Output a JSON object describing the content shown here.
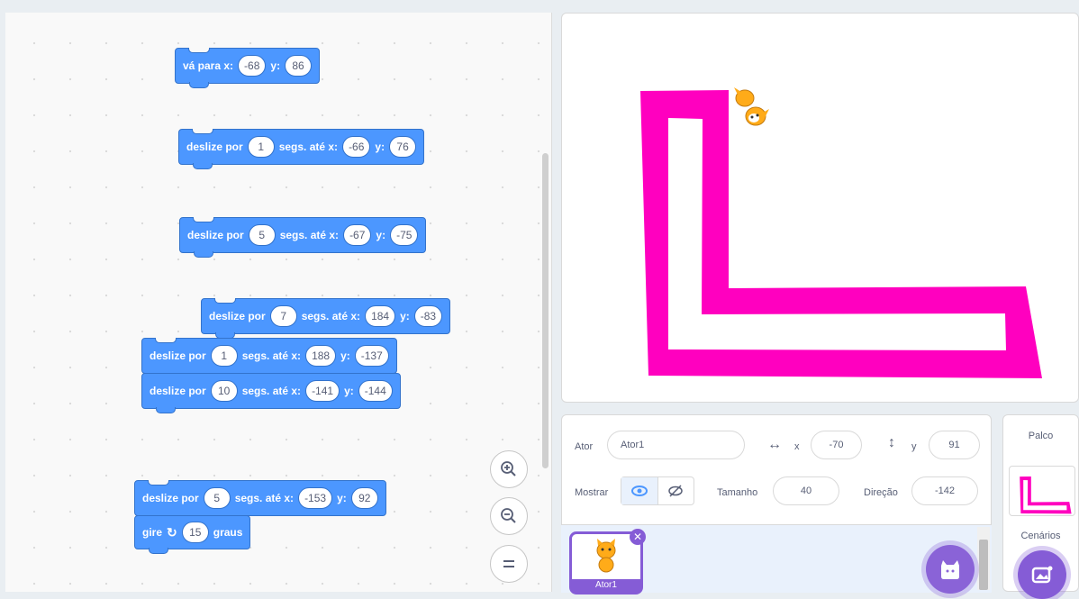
{
  "blocks": {
    "goto": {
      "label": "vá para x:",
      "x": "-68",
      "y_label": "y:",
      "y": "86"
    },
    "glide1": {
      "prefix": "deslize por",
      "secs": "1",
      "mid": "segs. até x:",
      "x": "-66",
      "y_label": "y:",
      "y": "76"
    },
    "glide2": {
      "prefix": "deslize por",
      "secs": "5",
      "mid": "segs. até x:",
      "x": "-67",
      "y_label": "y:",
      "y": "-75"
    },
    "glide3": {
      "prefix": "deslize por",
      "secs": "7",
      "mid": "segs. até x:",
      "x": "184",
      "y_label": "y:",
      "y": "-83"
    },
    "glide4": {
      "prefix": "deslize por",
      "secs": "1",
      "mid": "segs. até x:",
      "x": "188",
      "y_label": "y:",
      "y": "-137"
    },
    "glide5": {
      "prefix": "deslize por",
      "secs": "10",
      "mid": "segs. até x:",
      "x": "-141",
      "y_label": "y:",
      "y": "-144"
    },
    "glide6": {
      "prefix": "deslize por",
      "secs": "5",
      "mid": "segs. até x:",
      "x": "-153",
      "y_label": "y:",
      "y": "92"
    },
    "turn": {
      "prefix": "gire",
      "degrees": "15",
      "suffix": "graus"
    }
  },
  "sprite_info": {
    "actor_label": "Ator",
    "actor_name": "Ator1",
    "x_label": "x",
    "x": "-70",
    "y_label": "y",
    "y": "91",
    "show_label": "Mostrar",
    "size_label": "Tamanho",
    "size": "40",
    "direction_label": "Direção",
    "direction": "-142"
  },
  "sprite_list": {
    "thumb_name": "Ator1"
  },
  "stage_pane": {
    "title": "Palco",
    "backdrops_label": "Cenários"
  },
  "colors": {
    "pen": "#ff00bf",
    "block": "#4c97ff",
    "accent": "#855cd6"
  },
  "icons": [
    "zoom-in-icon",
    "zoom-out-icon",
    "zoom-reset-icon",
    "arrows-horizontal-icon",
    "arrows-vertical-icon",
    "eye-icon",
    "eye-slash-icon",
    "cat-add-icon",
    "backdrop-add-icon",
    "close-icon"
  ]
}
